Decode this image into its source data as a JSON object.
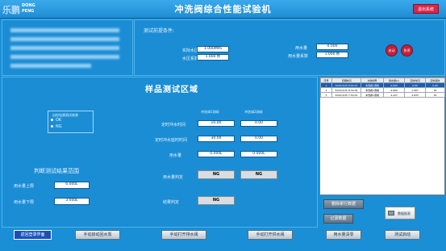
{
  "header": {
    "logo_cn": "乐鹏",
    "logo_en_top": "DONG",
    "logo_en_bottom": "PENG",
    "title": "冲洗阀综合性能试验机",
    "exit_button": "退出系统"
  },
  "precondition": {
    "title": "测试前提条件:",
    "static_pressure_label": "实际水压",
    "static_pressure_value": "1.000MPa",
    "water_coef_label": "水压系数",
    "water_coef_value": "1.000 秒",
    "flow_label": "用水量",
    "flow_value": "0.000",
    "flow_coef_label": "用水量系数",
    "flow_coef_value": "1.000 秒",
    "btn_start": "启动",
    "btn_stop": "急停"
  },
  "sample_zone": {
    "title": "样品测试区域",
    "judge_title": "自检电源测试结果",
    "opt_ok": "OK",
    "opt_ng": "NG",
    "range_title": "判断测试结果范围",
    "upper_label": "用水量上限",
    "upper_value": "6.000L",
    "lower_label": "用水量下限",
    "lower_value": "3.000L",
    "col1": "冲洗阀1测阀",
    "col2": "冲洗阀2测阀",
    "row_timing": "定时冲水时间",
    "row_timing_v1": "10.00",
    "row_timing_v2": "0.00",
    "row_delay": "定时冲水延时时间",
    "row_delay_v1": "30.00",
    "row_delay_v2": "0.00",
    "row_flow": "用水量",
    "row_flow_v1": "0.000L",
    "row_flow_v2": "0.000L",
    "row_flow_judge": "用水量判定",
    "judge_v1": "NG",
    "judge_v2": "NG",
    "row_final": "结果判定",
    "final_v": "NG"
  },
  "table": {
    "headers": [
      "序号",
      "日期时间",
      "冲洗阀号",
      "用水量(L)",
      "定时时间",
      "定时延时"
    ],
    "rows": [
      [
        "1",
        "2022/3/25 8:40:15",
        "冲洗阀1测阀",
        "0.000",
        "0.00",
        "0.00"
      ],
      [
        "2",
        "2022/3/25 8:30:36",
        "冲洗阀1测阀",
        "4.800",
        "1.567",
        "30"
      ],
      [
        "3",
        "2022/3/25 7:50:01",
        "冲洗阀1测阀",
        "4.227",
        "2.833",
        "30"
      ]
    ]
  },
  "right_buttons": {
    "save": "删除累行数据",
    "record": "记录数据",
    "print": "数据报表"
  },
  "bottom": {
    "back": "返回登录界面",
    "b1": "手动启动回水泵",
    "b2": "手动打开排水阀",
    "b3": "手动打开供水阀",
    "b4": "用水量清零",
    "b5": "测试启动"
  }
}
